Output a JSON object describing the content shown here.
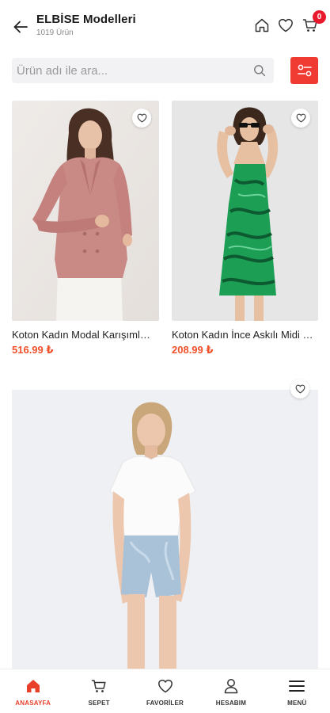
{
  "header": {
    "title": "ELBİSE Modelleri",
    "subtitle": "1019 Ürün",
    "cart_count": "0"
  },
  "search": {
    "placeholder": "Ürün adı ile ara..."
  },
  "products": [
    {
      "name": "Koton Kadın Modal Karışımlı Blazer Ceket",
      "price": "516.99 ₺"
    },
    {
      "name": "Koton Kadın İnce Askılı Midi Elbise",
      "price": "208.99 ₺"
    },
    {
      "name": "",
      "price": ""
    }
  ],
  "nav": {
    "items": [
      {
        "label": "ANASAYFA",
        "icon": "home-icon"
      },
      {
        "label": "SEPET",
        "icon": "cart-icon"
      },
      {
        "label": "FAVORİLER",
        "icon": "heart-icon"
      },
      {
        "label": "HESABIM",
        "icon": "user-icon"
      },
      {
        "label": "MENÜ",
        "icon": "menu-icon"
      }
    ]
  },
  "colors": {
    "accent": "#ef3b32",
    "price": "#f0502a",
    "badge": "#e8192c"
  }
}
